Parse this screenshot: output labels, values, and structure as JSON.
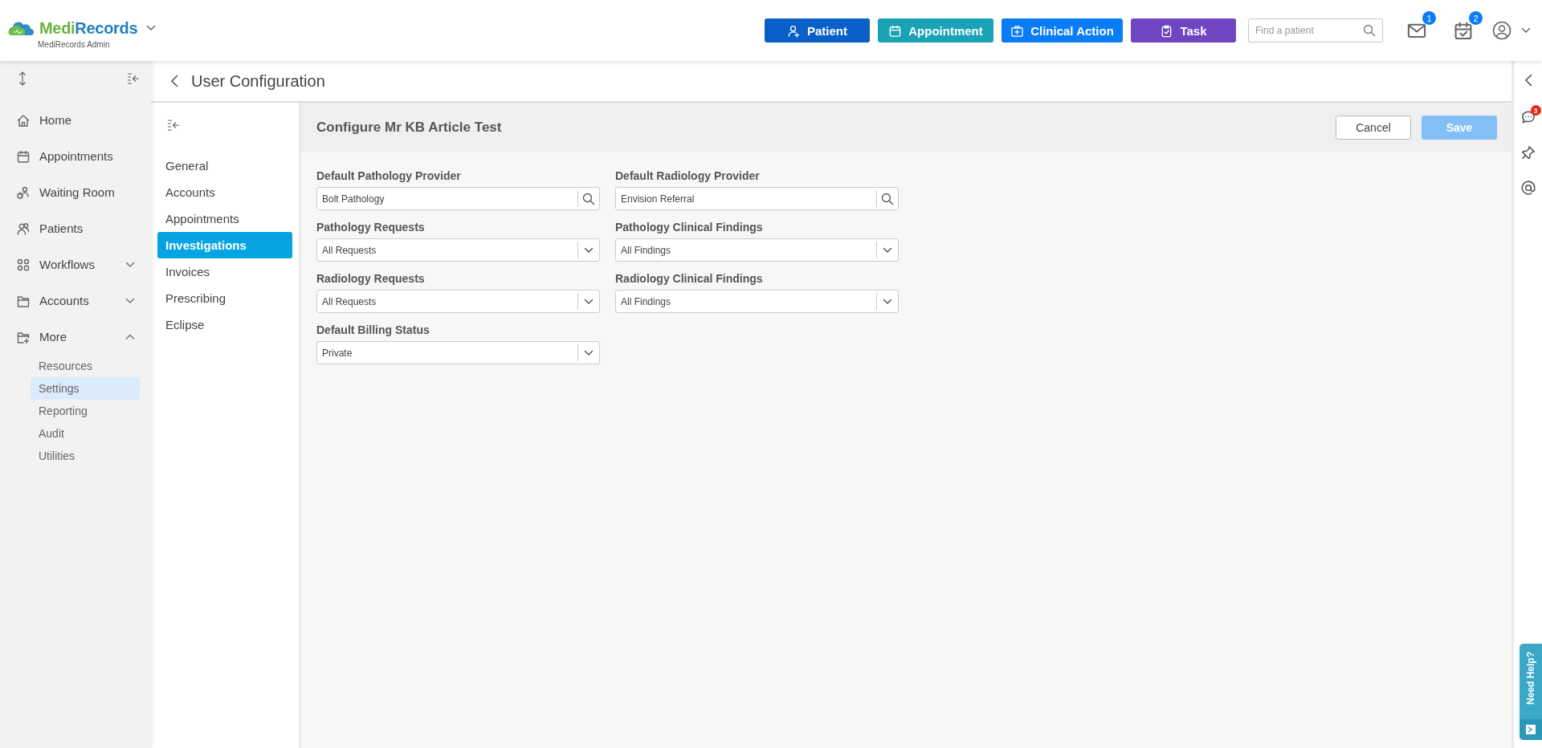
{
  "header": {
    "logo": {
      "brand_a": "Medi",
      "brand_b": "Records",
      "subtitle": "MediRecords Admin"
    },
    "actions": [
      {
        "label": "Patient",
        "color": "#0a60c8"
      },
      {
        "label": "Appointment",
        "color": "#1aa2b6"
      },
      {
        "label": "Clinical Action",
        "color": "#0a7cf8"
      },
      {
        "label": "Task",
        "color": "#7045c2"
      }
    ],
    "search": {
      "placeholder": "Find a patient"
    },
    "notifications": [
      {
        "badge": "1"
      },
      {
        "badge": "2"
      }
    ]
  },
  "sidebar": {
    "items": [
      {
        "label": "Home"
      },
      {
        "label": "Appointments"
      },
      {
        "label": "Waiting Room"
      },
      {
        "label": "Patients"
      },
      {
        "label": "Workflows",
        "expanded": false
      },
      {
        "label": "Accounts",
        "expanded": false
      },
      {
        "label": "More",
        "expanded": true,
        "children": [
          {
            "label": "Resources",
            "selected": false
          },
          {
            "label": "Settings",
            "selected": true
          },
          {
            "label": "Reporting",
            "selected": false
          },
          {
            "label": "Audit",
            "selected": false
          },
          {
            "label": "Utilities",
            "selected": false
          }
        ]
      }
    ]
  },
  "page": {
    "title": "User Configuration",
    "submenu": [
      {
        "label": "General",
        "selected": false
      },
      {
        "label": "Accounts",
        "selected": false
      },
      {
        "label": "Appointments",
        "selected": false
      },
      {
        "label": "Investigations",
        "selected": true
      },
      {
        "label": "Invoices",
        "selected": false
      },
      {
        "label": "Prescribing",
        "selected": false
      },
      {
        "label": "Eclipse",
        "selected": false
      }
    ],
    "form": {
      "title": "Configure Mr KB Article Test",
      "buttons": [
        {
          "label": "Cancel",
          "kind": "secondary",
          "disabled": false
        },
        {
          "label": "Save",
          "kind": "primary",
          "disabled": true
        }
      ],
      "fields": [
        {
          "label": "Default Pathology Provider",
          "kind": "search",
          "value": "Bolt Pathology"
        },
        {
          "label": "Default Radiology Provider",
          "kind": "search",
          "value": "Envision Referral"
        },
        {
          "label": "Pathology Requests",
          "kind": "select",
          "value": "All Requests"
        },
        {
          "label": "Pathology Clinical Findings",
          "kind": "select",
          "value": "All Findings"
        },
        {
          "label": "Radiology Requests",
          "kind": "select",
          "value": "All Requests"
        },
        {
          "label": "Radiology Clinical Findings",
          "kind": "select",
          "value": "All Findings"
        },
        {
          "label": "Default Billing Status",
          "kind": "select",
          "value": "Private"
        }
      ]
    }
  },
  "right_rail": {
    "chat_badge": "3",
    "help": {
      "label": "Need Help?"
    }
  }
}
